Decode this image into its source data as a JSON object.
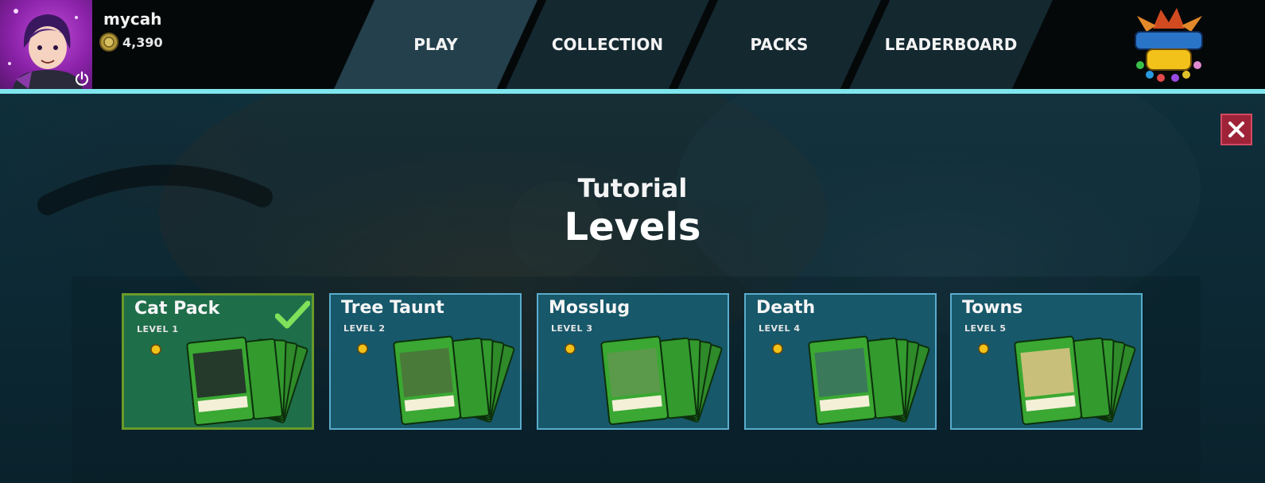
{
  "header": {
    "username": "mycah",
    "coins": "4,390",
    "logo_icon": "fractal-tcg-logo",
    "tabs": [
      {
        "label": "PLAY",
        "active": true
      },
      {
        "label": "COLLECTION",
        "active": false
      },
      {
        "label": "PACKS",
        "active": false
      },
      {
        "label": "LEADERBOARD",
        "active": false
      }
    ]
  },
  "colors": {
    "accent_line": "#7fe6ee",
    "close_button": "#9e2238",
    "completed_border": "#6a9a2a",
    "pending_border": "#5aaccd"
  },
  "modal": {
    "title_sub": "Tutorial",
    "title_main": "Levels",
    "levels": [
      {
        "name": "Cat Pack",
        "level": "LEVEL 1",
        "completed": true
      },
      {
        "name": "Tree Taunt",
        "level": "LEVEL 2",
        "completed": false
      },
      {
        "name": "Mosslug",
        "level": "LEVEL 3",
        "completed": false
      },
      {
        "name": "Death",
        "level": "LEVEL 4",
        "completed": false
      },
      {
        "name": "Towns",
        "level": "LEVEL 5",
        "completed": false
      }
    ]
  }
}
